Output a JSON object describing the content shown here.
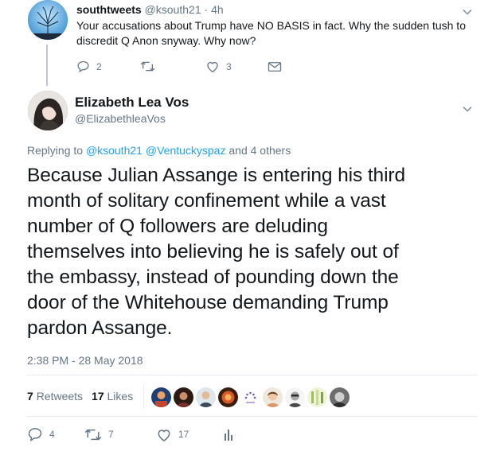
{
  "parent_tweet": {
    "display_name": "southtweets",
    "handle": "@ksouth21",
    "time": "4h",
    "text_line1": "Your accusations about Trump have NO BASIS in fact.  Why the sudden tush to",
    "text_line2": "discredit Q Anon snyway.  Why now?",
    "reply_count": "2",
    "retweet_count": "",
    "like_count": "3",
    "avatar_icon": "tree-silhouette-avatar",
    "colors": {
      "thread_line": "#c9bfe4",
      "avatar_bg": "#4aa3d6"
    }
  },
  "main_tweet": {
    "display_name": "Elizabeth Lea Vos",
    "handle": "@ElizabethleaVos",
    "replying_prefix": "Replying to",
    "reply_mention_1": "@ksouth21",
    "reply_mention_2": "@Ventuckyspaz",
    "reply_others": "and 4 others",
    "text_lines": [
      "Because Julian Assange is entering his third",
      "month of solitary confinement while a vast",
      "number of Q followers are deluding",
      "themselves into believing he is safely out of",
      "the embassy, instead of pounding down the",
      "door of the Whitehouse demanding Trump",
      "pardon Assange."
    ],
    "timestamp": "2:38 PM - 28 May 2018",
    "retweets_count": "7",
    "retweets_label": "Retweets",
    "likes_count": "17",
    "likes_label": "Likes",
    "reply_count": "4",
    "retweet_count": "7",
    "like_count": "17",
    "liker_avatars": [
      "avatar-1",
      "avatar-2",
      "avatar-3",
      "avatar-4",
      "avatar-5",
      "avatar-6",
      "avatar-7",
      "avatar-8",
      "avatar-9"
    ],
    "colors": {
      "link": "#1da1f2",
      "muted": "#657786",
      "text": "#14171a",
      "divider": "#e6ecf0"
    }
  }
}
